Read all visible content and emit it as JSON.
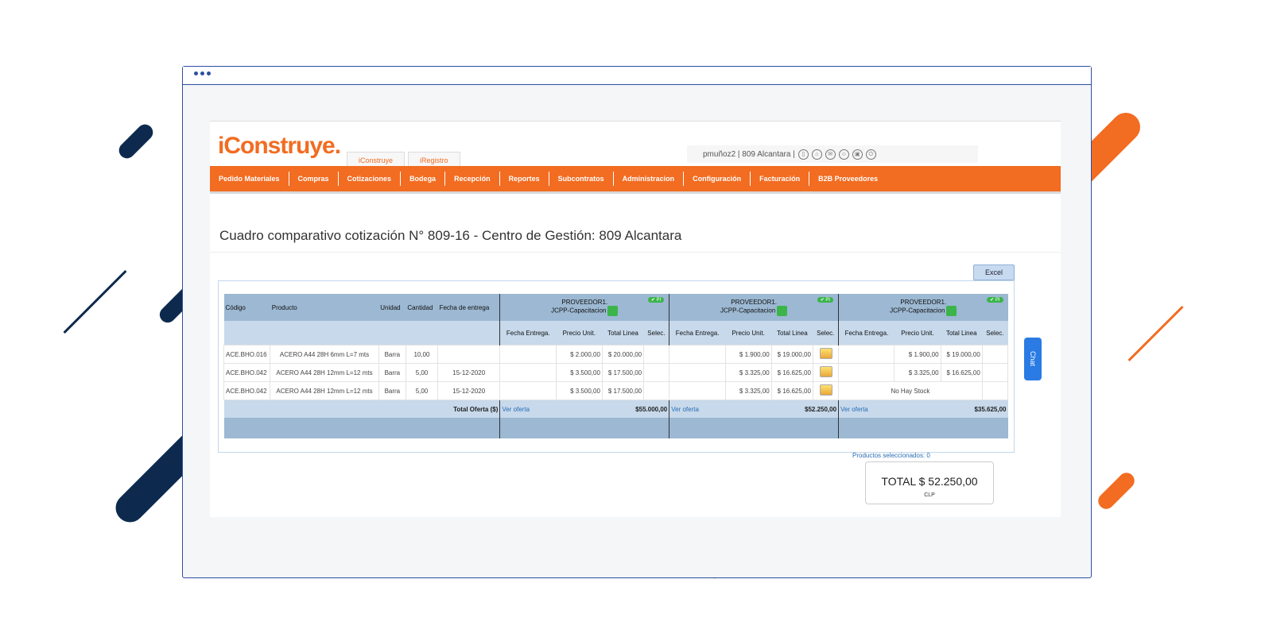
{
  "app": {
    "logo": "iConstruye.",
    "tabs": [
      "iConstruye",
      "iRegistro"
    ],
    "user": "pmuñoz2 | 809 Alcantara |",
    "menu": [
      "Pedido Materiales",
      "Compras",
      "Cotizaciones",
      "Bodega",
      "Recepción",
      "Reportes",
      "Subcontratos",
      "Administracion",
      "Configuración",
      "Facturación",
      "B2B Proveedores"
    ],
    "page_title": "Cuadro comparativo cotización N° 809-16 - Centro de Gestión: 809 Alcantara",
    "excel_label": "Excel"
  },
  "table": {
    "headers": [
      "Código",
      "Producto",
      "Unidad",
      "Cantidad",
      "Fecha de entrega"
    ],
    "providers": [
      {
        "name": "PROVEEDOR1.",
        "sub": "JCPP-Capacitacion",
        "badge": "✔ PI"
      },
      {
        "name": "PROVEEDOR1.",
        "sub": "JCPP-Capacitacion",
        "badge": "✔ PI"
      },
      {
        "name": "PROVEEDOR1.",
        "sub": "JCPP-Capacitacion",
        "badge": "✔ PI"
      }
    ],
    "sub_headers": [
      "Fecha Entrega.",
      "Precio Unit.",
      "Total Linea",
      "Selec."
    ],
    "rows": [
      {
        "code": "ACE.BHO.016",
        "product": "ACERO A44 28H 6mm L=7 mts",
        "unit": "Barra",
        "qty": "10,00",
        "date": "",
        "p1": [
          "$ 2.000,00",
          "$ 20.000,00"
        ],
        "p2": [
          "$ 1.900,00",
          "$ 19.000,00"
        ],
        "p3": [
          "$ 1.900,00",
          "$ 19.000,00"
        ]
      },
      {
        "code": "ACE.BHO.042",
        "product": "ACERO A44 28H 12mm L=12 mts",
        "unit": "Barra",
        "qty": "5,00",
        "date": "15-12-2020",
        "p1": [
          "$ 3.500,00",
          "$ 17.500,00"
        ],
        "p2": [
          "$ 3.325,00",
          "$ 16.625,00"
        ],
        "p3": [
          "$ 3.325,00",
          "$ 16.625,00"
        ]
      },
      {
        "code": "ACE.BHO.042",
        "product": "ACERO A44 28H 12mm L=12 mts",
        "unit": "Barra",
        "qty": "5,00",
        "date": "15-12-2020",
        "p1": [
          "$ 3.500,00",
          "$ 17.500,00"
        ],
        "p2": [
          "$ 3.325,00",
          "$ 16.625,00"
        ],
        "p3_text": "No Hay Stock"
      }
    ],
    "total_label": "Total Oferta ($)",
    "ver_oferta": "Ver oferta",
    "totals": [
      "$55.000,00",
      "$52.250,00",
      "$35.625,00"
    ]
  },
  "summary": {
    "selected": "Productos seleccionados: 0",
    "total": "TOTAL $ 52.250,00",
    "currency": "CLP"
  },
  "chat_label": "Chat",
  "colors": {
    "brand": "#f26c21",
    "navy": "#0d2a4e",
    "header": "#9cb8d2"
  }
}
